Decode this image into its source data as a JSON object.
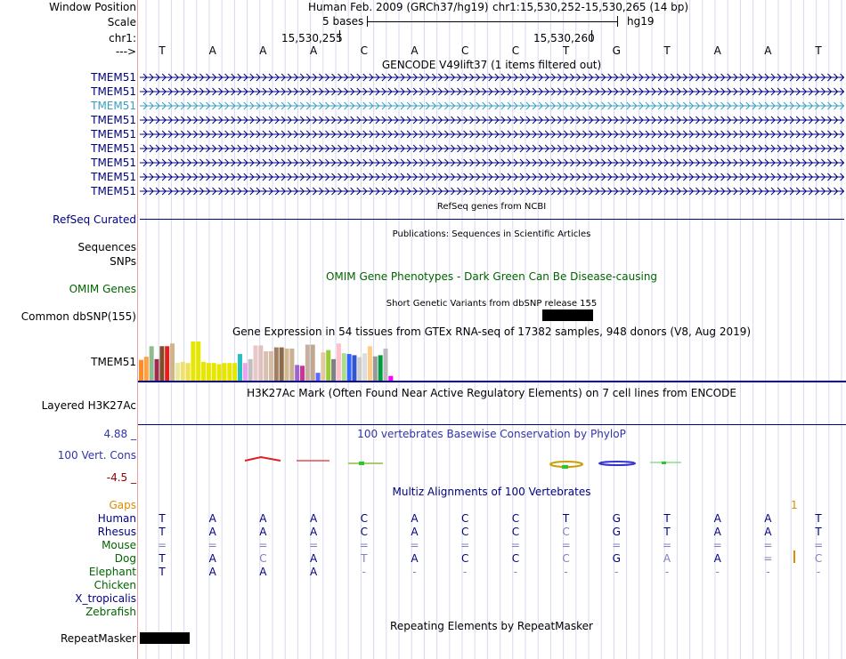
{
  "header": {
    "window_position_label": "Window Position",
    "scale_label": "Scale",
    "chrom_label": "chr1:",
    "arrow_label": "--->",
    "assembly_text": "Human Feb. 2009 (GRCh37/hg19)",
    "position_text": "chr1:15,530,252-15,530,265 (14 bp)",
    "scale_text": "5 bases",
    "db_text": "hg19",
    "tick_left": "15,530,255",
    "tick_right": "15,530,260"
  },
  "bases": [
    "T",
    "A",
    "A",
    "A",
    "C",
    "A",
    "C",
    "C",
    "T",
    "G",
    "T",
    "A",
    "A",
    "T"
  ],
  "gencode": {
    "title": "GENCODE V49lift37 (1 items filtered out)",
    "genes": [
      "TMEM51",
      "TMEM51",
      "TMEM51",
      "TMEM51",
      "TMEM51",
      "TMEM51",
      "TMEM51",
      "TMEM51",
      "TMEM51"
    ],
    "highlight_index": 2
  },
  "refseq": {
    "label": "RefSeq Curated",
    "title": "RefSeq genes from NCBI"
  },
  "publications": {
    "title": "Publications: Sequences in Scientific Articles",
    "label": "Sequences"
  },
  "snps_label": "SNPs",
  "omim": {
    "label": "OMIM Genes",
    "title": "OMIM Gene Phenotypes - Dark Green Can Be Disease-causing"
  },
  "dbsnp": {
    "label": "Common dbSNP(155)",
    "title": "Short Genetic Variants from dbSNP release 155"
  },
  "gtex": {
    "title": "Gene Expression in 54 tissues from GTEx RNA-seq of 17382 samples, 948 donors (V8, Aug 2019)",
    "label": "TMEM51",
    "bars": [
      {
        "v": 0.53,
        "c": "#ff8c2a"
      },
      {
        "v": 0.61,
        "c": "#ffa040"
      },
      {
        "v": 0.88,
        "c": "#8fbc8f"
      },
      {
        "v": 0.55,
        "c": "#a0294f"
      },
      {
        "v": 0.88,
        "c": "#7a4f29"
      },
      {
        "v": 0.88,
        "c": "#e02020"
      },
      {
        "v": 0.95,
        "c": "#d2b48c"
      },
      {
        "v": 0.45,
        "c": "#e8e8a0"
      },
      {
        "v": 0.48,
        "c": "#f0e070"
      },
      {
        "v": 0.45,
        "c": "#f0e050"
      },
      {
        "v": 1.0,
        "c": "#e6e600"
      },
      {
        "v": 1.0,
        "c": "#e6e600"
      },
      {
        "v": 0.48,
        "c": "#e6e600"
      },
      {
        "v": 0.45,
        "c": "#e6e600"
      },
      {
        "v": 0.45,
        "c": "#e6e600"
      },
      {
        "v": 0.42,
        "c": "#e6e600"
      },
      {
        "v": 0.45,
        "c": "#e6e600"
      },
      {
        "v": 0.45,
        "c": "#e6e600"
      },
      {
        "v": 0.45,
        "c": "#e6e600"
      },
      {
        "v": 0.68,
        "c": "#22c0c0"
      },
      {
        "v": 0.45,
        "c": "#f0a0f0"
      },
      {
        "v": 0.55,
        "c": "#c0c0c0"
      },
      {
        "v": 0.9,
        "c": "#e8c8c8"
      },
      {
        "v": 0.9,
        "c": "#e0c0c0"
      },
      {
        "v": 0.75,
        "c": "#d8c0b0"
      },
      {
        "v": 0.75,
        "c": "#d4bca8"
      },
      {
        "v": 0.85,
        "c": "#a08060"
      },
      {
        "v": 0.85,
        "c": "#8b6b4b"
      },
      {
        "v": 0.82,
        "c": "#d0b890"
      },
      {
        "v": 0.82,
        "c": "#c8b090"
      },
      {
        "v": 0.4,
        "c": "#9966cc"
      },
      {
        "v": 0.38,
        "c": "#cc3399"
      },
      {
        "v": 0.92,
        "c": "#c8b0a0"
      },
      {
        "v": 0.92,
        "c": "#c0a890"
      },
      {
        "v": 0.2,
        "c": "#6666ff"
      },
      {
        "v": 0.72,
        "c": "#e0c8a0"
      },
      {
        "v": 0.78,
        "c": "#99cc33"
      },
      {
        "v": 0.55,
        "c": "#808080"
      },
      {
        "v": 0.95,
        "c": "#ffc0cb"
      },
      {
        "v": 0.7,
        "c": "#aadd88"
      },
      {
        "v": 0.68,
        "c": "#3366ff"
      },
      {
        "v": 0.65,
        "c": "#3355cc"
      },
      {
        "v": 0.6,
        "c": "#cccccc"
      },
      {
        "v": 0.7,
        "c": "#dddddd"
      },
      {
        "v": 0.88,
        "c": "#ffcc88"
      },
      {
        "v": 0.62,
        "c": "#999999"
      },
      {
        "v": 0.65,
        "c": "#009944"
      },
      {
        "v": 0.82,
        "c": "#bbbbbb"
      },
      {
        "v": 0.12,
        "c": "#ff00ff"
      }
    ]
  },
  "h3k27ac": {
    "label": "Layered H3K27Ac",
    "title": "H3K27Ac Mark (Often Found Near Active Regulatory Elements) on 7 cell lines from ENCODE"
  },
  "phylop": {
    "label": "100 Vert. Cons",
    "title": "100 vertebrates Basewise Conservation by PhyloP",
    "max": "4.88 _",
    "min": "-4.5 _"
  },
  "multiz": {
    "title": "Multiz Alignments of 100 Vertebrates",
    "gaps_label": "Gaps",
    "gap_count": "1",
    "species": [
      {
        "name": "Human",
        "color": "#000080",
        "seq": [
          "T",
          "A",
          "A",
          "A",
          "C",
          "A",
          "C",
          "C",
          "T",
          "G",
          "T",
          "A",
          "A",
          "T"
        ]
      },
      {
        "name": "Rhesus",
        "color": "#000080",
        "seq": [
          "T",
          "A",
          "A",
          "A",
          "C",
          "A",
          "C",
          "C",
          "C",
          "G",
          "T",
          "A",
          "A",
          "T"
        ]
      },
      {
        "name": "Mouse",
        "color": "#006400",
        "seq": [
          "=",
          "=",
          "=",
          "=",
          "=",
          "=",
          "=",
          "=",
          "=",
          "=",
          "=",
          "=",
          "=",
          "="
        ]
      },
      {
        "name": "Dog",
        "color": "#006400",
        "seq": [
          "T",
          "A",
          "C",
          "A",
          "T",
          "A",
          "C",
          "C",
          "C",
          "G",
          "A",
          "A",
          "=",
          "C"
        ]
      },
      {
        "name": "Elephant",
        "color": "#006400",
        "seq": [
          "T",
          "A",
          "A",
          "A",
          "-",
          "-",
          "-",
          "-",
          "-",
          "-",
          "-",
          "-",
          "-",
          "-"
        ]
      },
      {
        "name": "Chicken",
        "color": "#006400",
        "seq": []
      },
      {
        "name": "X_tropicalis",
        "color": "#000080",
        "seq": []
      },
      {
        "name": "Zebrafish",
        "color": "#006400",
        "seq": []
      }
    ]
  },
  "repeatmasker": {
    "label": "RepeatMasker",
    "title": "Repeating Elements by RepeatMasker"
  }
}
